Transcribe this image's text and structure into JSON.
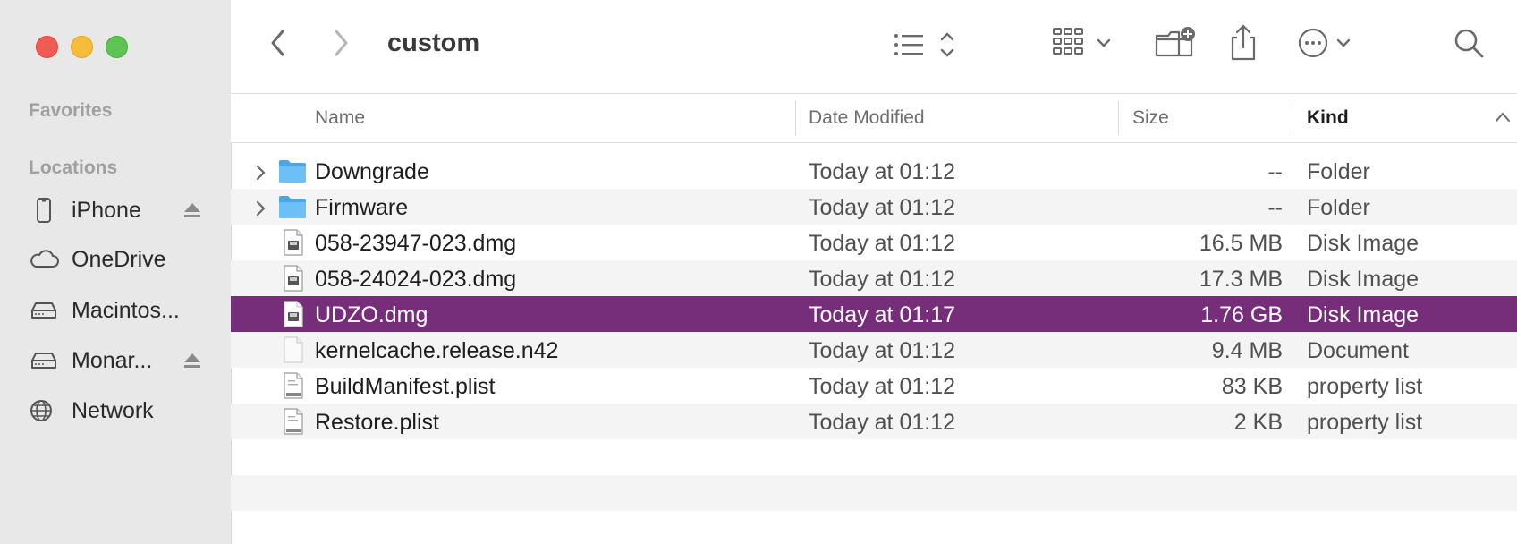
{
  "window": {
    "title": "custom"
  },
  "sidebar": {
    "favorites_title": "Favorites",
    "locations_title": "Locations",
    "items": [
      {
        "label": "iPhone",
        "icon": "iphone-icon",
        "eject": true
      },
      {
        "label": "OneDrive",
        "icon": "cloud-icon",
        "eject": false
      },
      {
        "label": "Macintos...",
        "icon": "drive-icon",
        "eject": false
      },
      {
        "label": "Monar...",
        "icon": "drive-icon",
        "eject": true
      },
      {
        "label": "Network",
        "icon": "globe-icon",
        "eject": false
      }
    ]
  },
  "toolbar": {
    "back_icon": "chevron-left-icon",
    "forward_icon": "chevron-right-icon",
    "view_icon": "list-view-icon",
    "group_icon": "grid-group-icon",
    "new_folder_icon": "new-folder-icon",
    "share_icon": "share-icon",
    "more_icon": "ellipsis-circle-icon",
    "search_icon": "search-icon"
  },
  "columns": {
    "name": "Name",
    "date": "Date Modified",
    "size": "Size",
    "kind": "Kind"
  },
  "files": [
    {
      "name": "Downgrade",
      "date": "Today at 01:12",
      "size": "--",
      "kind": "Folder",
      "type": "folder",
      "selected": false
    },
    {
      "name": "Firmware",
      "date": "Today at 01:12",
      "size": "--",
      "kind": "Folder",
      "type": "folder",
      "selected": false
    },
    {
      "name": "058-23947-023.dmg",
      "date": "Today at 01:12",
      "size": "16.5 MB",
      "kind": "Disk Image",
      "type": "dmg",
      "selected": false
    },
    {
      "name": "058-24024-023.dmg",
      "date": "Today at 01:12",
      "size": "17.3 MB",
      "kind": "Disk Image",
      "type": "dmg",
      "selected": false
    },
    {
      "name": "UDZO.dmg",
      "date": "Today at 01:17",
      "size": "1.76 GB",
      "kind": "Disk Image",
      "type": "dmg",
      "selected": true
    },
    {
      "name": "kernelcache.release.n42",
      "date": "Today at 01:12",
      "size": "9.4 MB",
      "kind": "Document",
      "type": "doc",
      "selected": false
    },
    {
      "name": "BuildManifest.plist",
      "date": "Today at 01:12",
      "size": "83 KB",
      "kind": "property list",
      "type": "plist",
      "selected": false
    },
    {
      "name": "Restore.plist",
      "date": "Today at 01:12",
      "size": "2 KB",
      "kind": "property list",
      "type": "plist",
      "selected": false
    }
  ],
  "colors": {
    "selection": "#772e7a",
    "folder": "#62b7ef",
    "sidebar_bg": "#e8e8e8"
  }
}
